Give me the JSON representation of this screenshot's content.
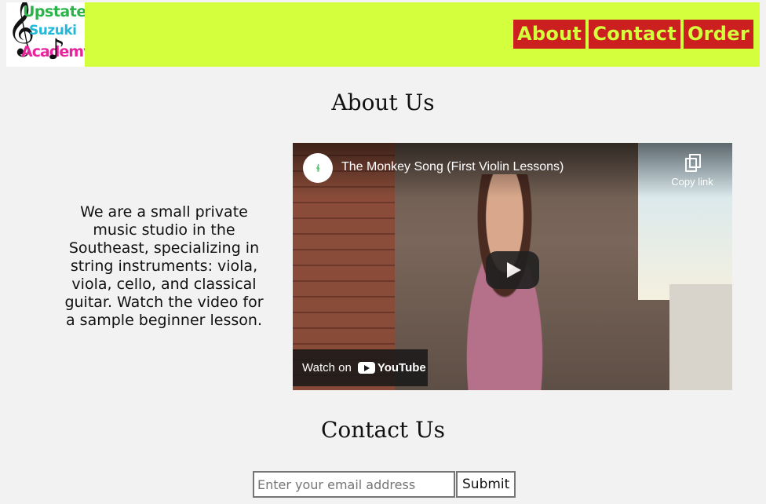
{
  "header": {
    "logo": {
      "line1": "Upstate",
      "line2": "Suzuki",
      "line3": "Academy"
    },
    "nav": [
      {
        "label": "About"
      },
      {
        "label": "Contact"
      },
      {
        "label": "Order"
      }
    ],
    "background_color": "#d4ff3c",
    "nav_color": "#cc1f1f"
  },
  "about": {
    "title": "About Us",
    "text": "We are a small private music studio in the Southeast, specializing in string instruments: viola, viola, cello, and classical guitar. Watch the video for a sample beginner lesson."
  },
  "video": {
    "title": "The Monkey Song (First Violin Lessons)",
    "copy_label": "Copy link",
    "watch_label": "Watch on",
    "platform": "YouTube"
  },
  "contact": {
    "title": "Contact Us",
    "email_placeholder": "Enter your email address",
    "submit_label": "Submit"
  }
}
